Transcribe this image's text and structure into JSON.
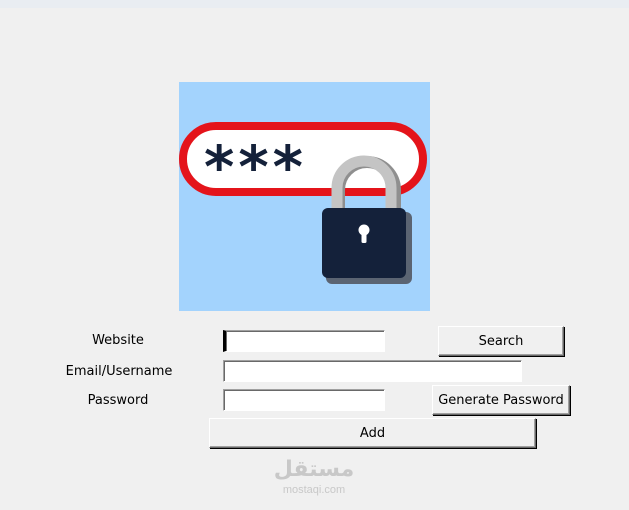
{
  "form": {
    "website_label": "Website",
    "email_label": "Email/Username",
    "password_label": "Password",
    "website_value": "",
    "email_value": "",
    "password_value": ""
  },
  "buttons": {
    "search_label": "Search",
    "generate_label": "Generate Password",
    "add_label": "Add"
  },
  "logo": {
    "icon": "password-lock-icon",
    "masked_text": "***",
    "background_color": "#a3d3fd",
    "ring_color": "#e4141b",
    "lock_body_color": "#14213a",
    "shackle_color": "#c4c4c4"
  },
  "watermark": {
    "logo_text": "مستقل",
    "url": "mostaqi.com"
  }
}
